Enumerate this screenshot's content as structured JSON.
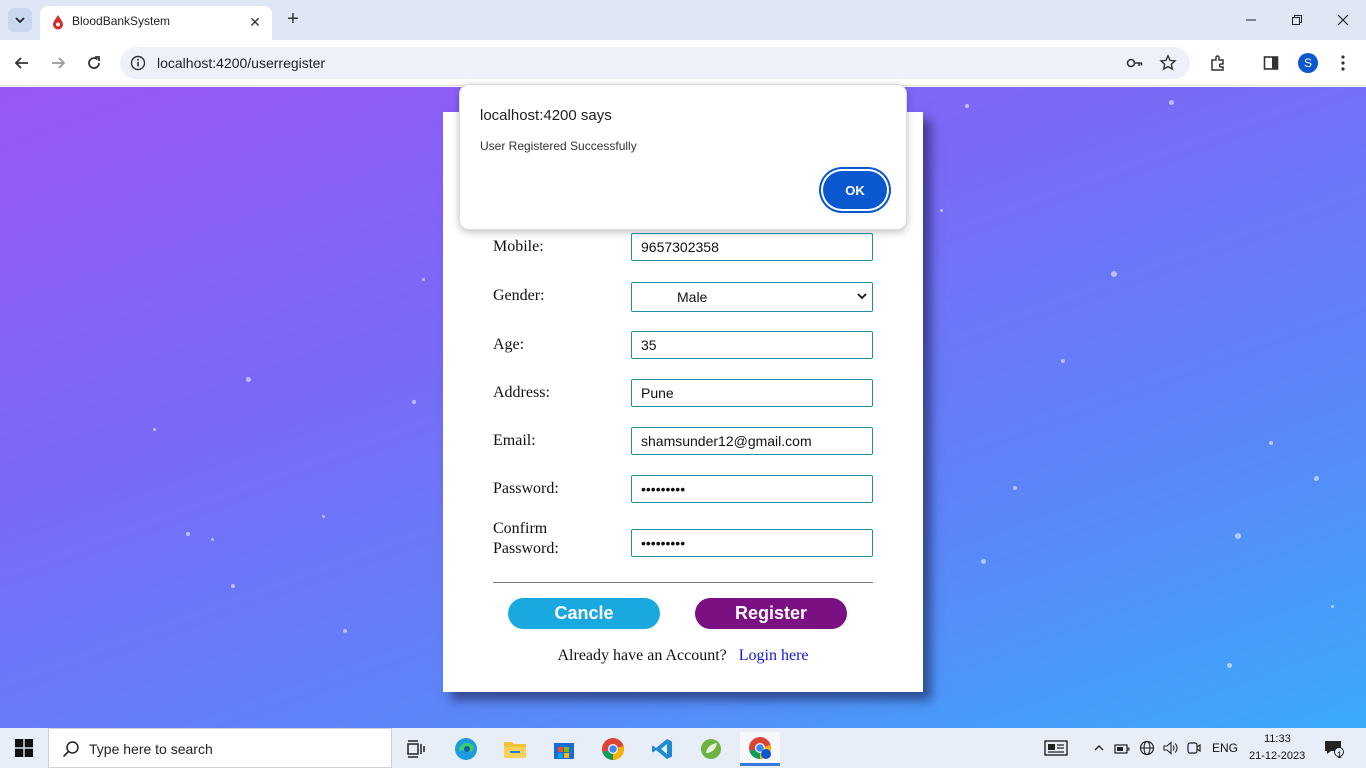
{
  "browser": {
    "tab_title": "BloodBankSystem",
    "url": "localhost:4200/userregister",
    "profile_initial": "S"
  },
  "form": {
    "mobile_label": "Mobile:",
    "mobile_value": "9657302358",
    "gender_label": "Gender:",
    "gender_value": "Male",
    "age_label": "Age:",
    "age_value": "35",
    "address_label": "Address:",
    "address_value": "Pune",
    "email_label": "Email:",
    "email_value": "shamsunder12@gmail.com",
    "password_label": "Password:",
    "password_value": "•••••••••",
    "confirm_label_line1": "Confirm",
    "confirm_label_line2": "Password:",
    "confirm_value": "•••••••••",
    "cancel_label": "Cancle",
    "register_label": "Register",
    "login_prompt": "Already have an Account?",
    "login_link": "Login here"
  },
  "dialog": {
    "title": "localhost:4200 says",
    "message": "User Registered Successfully",
    "ok_label": "OK"
  },
  "taskbar": {
    "search_placeholder": "Type here to search",
    "language": "ENG",
    "time": "11:33",
    "date": "21-12-2023",
    "notification_count": "1"
  },
  "colors": {
    "accent": "#0b57d0",
    "cancel_button": "#1aa8e0",
    "register_button": "#7b1082",
    "link": "#1515d8"
  }
}
